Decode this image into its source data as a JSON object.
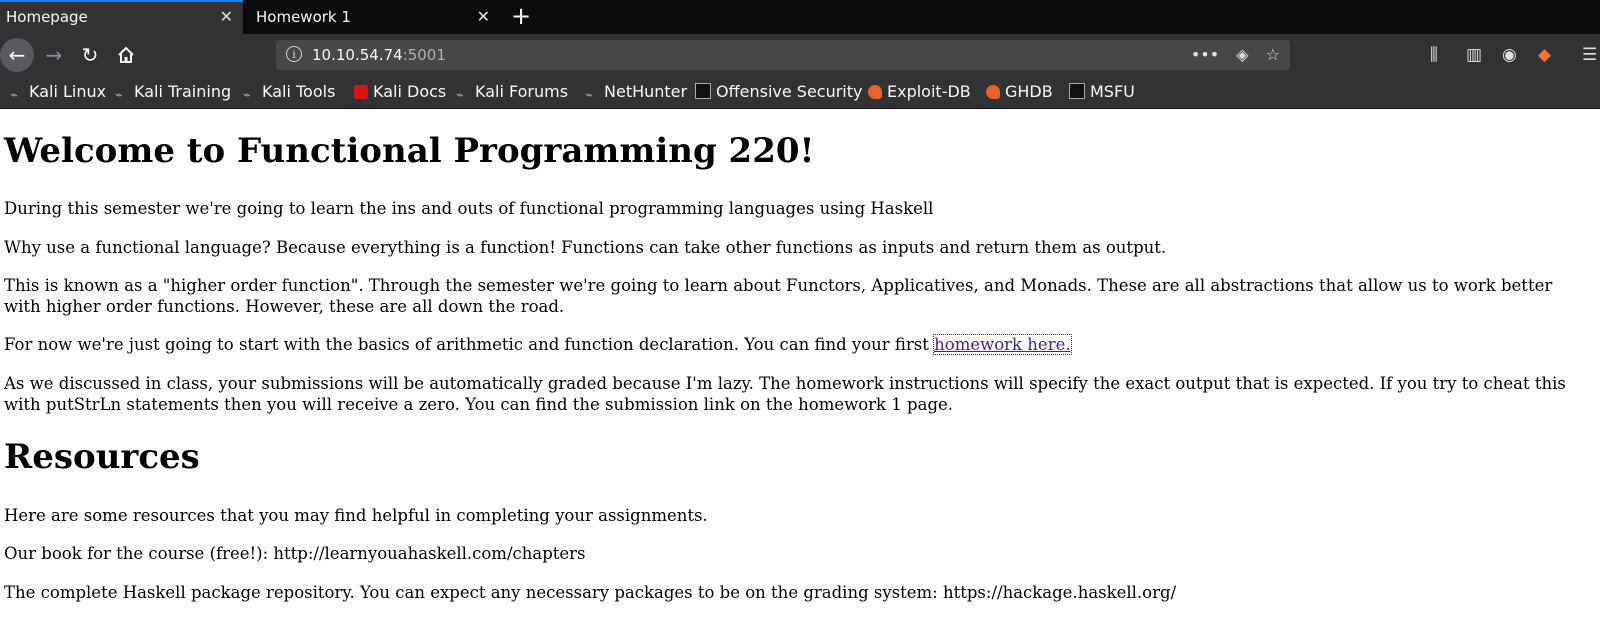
{
  "tabs": [
    {
      "label": "Homepage",
      "active": true
    },
    {
      "label": "Homework 1",
      "active": false
    }
  ],
  "urlbar": {
    "host": "10.10.54.74",
    "port": ":5001"
  },
  "bookmarks": [
    {
      "label": "Kali Linux",
      "icon": "kali-dragon-icon"
    },
    {
      "label": "Kali Training",
      "icon": "kali-dragon-icon"
    },
    {
      "label": "Kali Tools",
      "icon": "kali-dragon-icon"
    },
    {
      "label": "Kali Docs",
      "icon": "kali-docs-icon"
    },
    {
      "label": "Kali Forums",
      "icon": "kali-dragon-icon"
    },
    {
      "label": "NetHunter",
      "icon": "nethunter-icon"
    },
    {
      "label": "Offensive Security",
      "icon": "offsec-icon"
    },
    {
      "label": "Exploit-DB",
      "icon": "exploitdb-icon"
    },
    {
      "label": "GHDB",
      "icon": "ghdb-icon"
    },
    {
      "label": "MSFU",
      "icon": "offsec-icon"
    }
  ],
  "page": {
    "title": "Welcome to Functional Programming 220!",
    "p1": "During this semester we're going to learn the ins and outs of functional programming languages using Haskell",
    "p2": "Why use a functional language? Because everything is a function! Functions can take other functions as inputs and return them as output.",
    "p3": "This is known as a \"higher order function\". Through the semester we're going to learn about Functors, Applicatives, and Monads. These are all abstractions that allow us to work better with higher order functions. However, these are all down the road.",
    "p4_text": "For now we're just going to start with the basics of arithmetic and function declaration. You can find your first ",
    "p4_link": "homework here.",
    "p5": "As we discussed in class, your submissions will be automatically graded because I'm lazy. The homework instructions will specify the exact output that is expected. If you try to cheat this with putStrLn statements then you will receive a zero. You can find the submission link on the homework 1 page.",
    "resources_heading": "Resources",
    "r1": "Here are some resources that you may find helpful in completing your assignments.",
    "r2": "Our book for the course (free!): http://learnyouahaskell.com/chapters",
    "r3": "The complete Haskell package repository. You can expect any necessary packages to be on the grading system: https://hackage.haskell.org/"
  },
  "colors": {
    "link": "#551a8b",
    "accent": "#0a84ff"
  }
}
